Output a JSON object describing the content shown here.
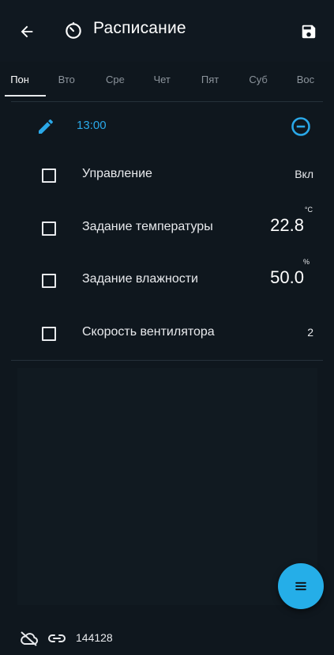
{
  "appbar": {
    "title": "Расписание",
    "back_icon": "arrow-left-icon",
    "title_icon": "timer-icon",
    "save_icon": "save-icon"
  },
  "tabs": [
    {
      "label": "Пон",
      "active": true
    },
    {
      "label": "Вто",
      "active": false
    },
    {
      "label": "Сре",
      "active": false
    },
    {
      "label": "Чет",
      "active": false
    },
    {
      "label": "Пят",
      "active": false
    },
    {
      "label": "Суб",
      "active": false
    },
    {
      "label": "Вос",
      "active": false
    }
  ],
  "schedule": {
    "time": "13:00",
    "edit_icon": "pencil-icon",
    "remove_icon": "minus-circle-icon",
    "params": [
      {
        "label": "Управление",
        "value": "Вкл",
        "unit": ""
      },
      {
        "label": "Задание температуры",
        "value": "22.8",
        "unit": "°C"
      },
      {
        "label": "Задание влажности",
        "value": "50.0",
        "unit": "%"
      },
      {
        "label": "Скорость вентилятора",
        "value": "2",
        "unit": ""
      }
    ]
  },
  "fab": {
    "icon": "menu-icon"
  },
  "status": {
    "cloud_icon": "cloud-off-icon",
    "link_icon": "link-icon",
    "device_id": "144128"
  },
  "colors": {
    "background": "#0f171e",
    "accent": "#25aee8",
    "time_text": "#2aa8e8"
  }
}
